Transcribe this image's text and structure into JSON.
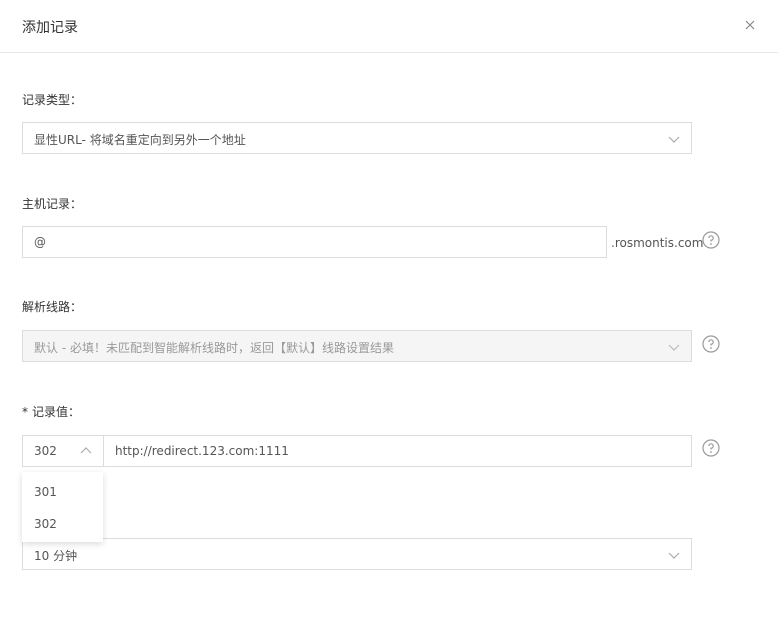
{
  "dialog": {
    "title": "添加记录"
  },
  "record_type": {
    "label": "记录类型：",
    "value": "显性URL- 将域名重定向到另外一个地址"
  },
  "host_record": {
    "label": "主机记录：",
    "value": "@",
    "suffix": ".rosmontis.com"
  },
  "line": {
    "label": "解析线路：",
    "value": "默认 - 必填！未匹配到智能解析线路时，返回【默认】线路设置结果"
  },
  "record_value": {
    "required_mark": "*",
    "label": "记录值：",
    "protocol": "302",
    "url": "http://redirect.123.com:1111",
    "options": [
      "301",
      "302"
    ]
  },
  "ttl": {
    "value": "10 分钟"
  },
  "icons": {
    "close": "close-icon",
    "chevron_down": "chevron-down-icon",
    "chevron_up": "chevron-up-icon",
    "help": "help-circle-icon"
  }
}
